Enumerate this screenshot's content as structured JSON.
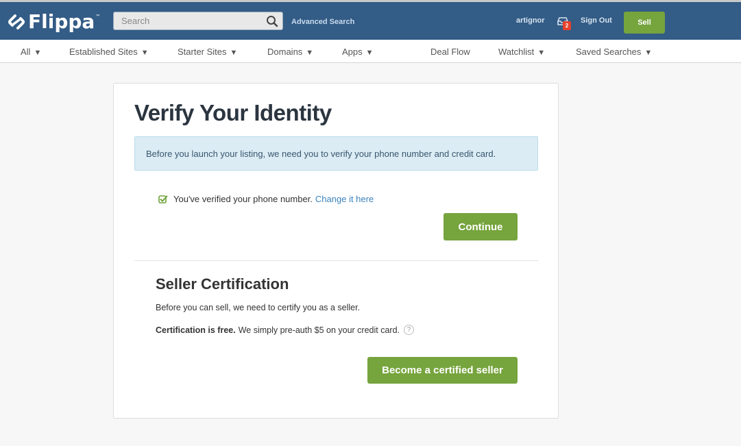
{
  "header": {
    "brand": "Flippa",
    "brand_tm": "™",
    "search_placeholder": "Search",
    "search_value": "",
    "advanced_search": "Advanced Search",
    "username": "artignor",
    "inbox_count": "2",
    "sign_out": "Sign Out",
    "sell": "Sell"
  },
  "nav": {
    "items": [
      {
        "label": "All",
        "dropdown": true
      },
      {
        "label": "Established Sites",
        "dropdown": true
      },
      {
        "label": "Starter Sites",
        "dropdown": true
      },
      {
        "label": "Domains",
        "dropdown": true
      },
      {
        "label": "Apps",
        "dropdown": true
      },
      {
        "label": "Deal Flow",
        "dropdown": false
      },
      {
        "label": "Watchlist",
        "dropdown": true
      },
      {
        "label": "Saved Searches",
        "dropdown": true
      }
    ],
    "caret": "▼"
  },
  "main": {
    "title": "Verify Your Identity",
    "info": "Before you launch your listing, we need you to verify your phone number and credit card.",
    "verified_text": "You've verified your phone number.",
    "change_link": "Change it here",
    "continue": "Continue",
    "cert_title": "Seller Certification",
    "cert_desc": "Before you can sell, we need to certify you as a seller.",
    "cert_free_bold": "Certification is free.",
    "cert_free_rest": "We simply pre-auth $5 on your credit card.",
    "help": "?",
    "certify_button": "Become a certified seller"
  },
  "colors": {
    "header_bg": "#335c86",
    "accent_green": "#76a43d",
    "link_blue": "#3a82bd",
    "badge_red": "#e5412d",
    "info_bg": "#dcecf4"
  }
}
